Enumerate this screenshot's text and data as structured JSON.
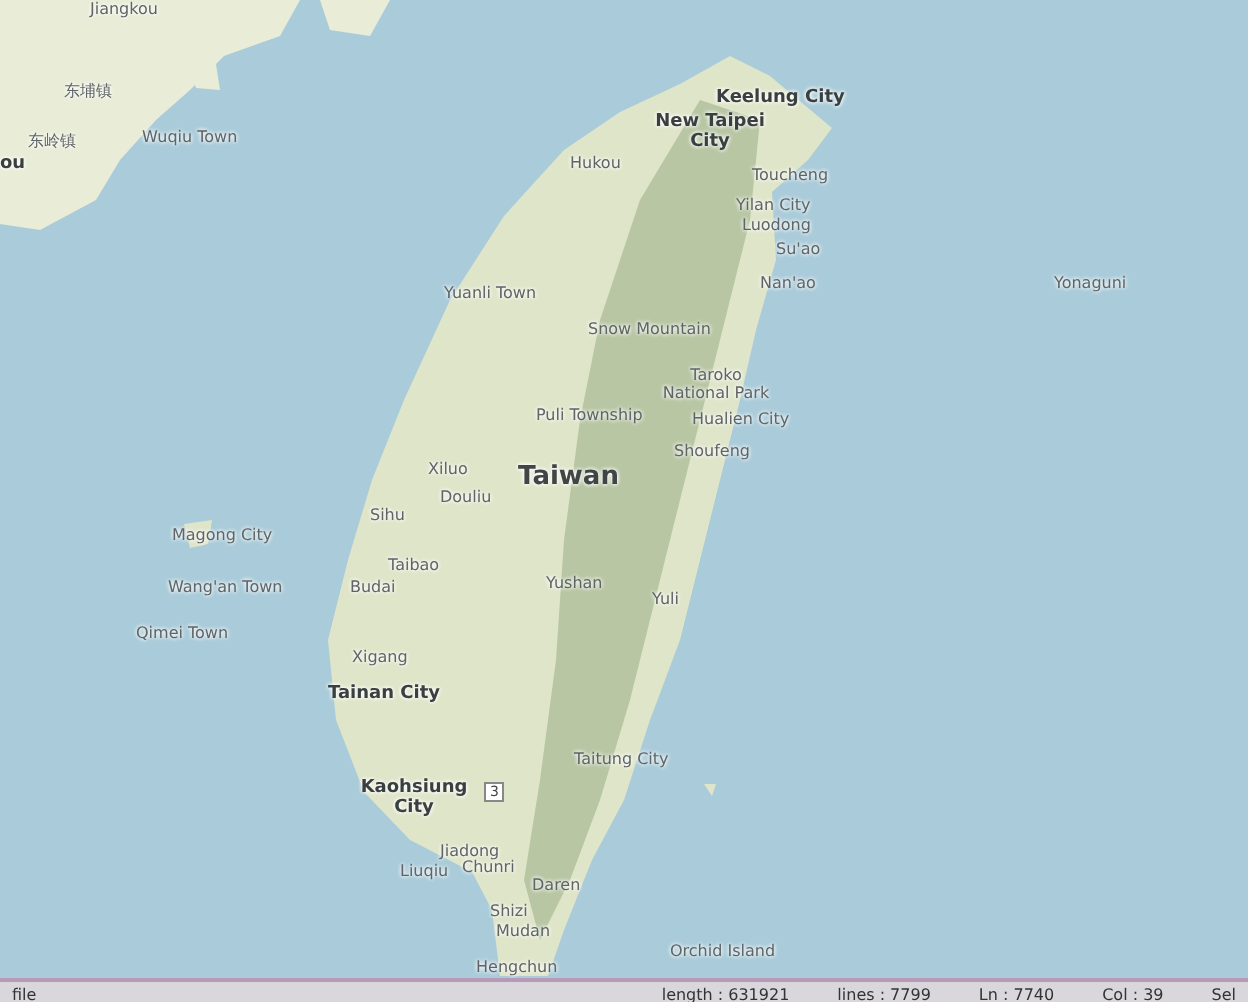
{
  "map": {
    "labels": [
      {
        "text": "Jiangkou",
        "kind": "town"
      },
      {
        "text": "东埔镇",
        "kind": "town"
      },
      {
        "text": "东岭镇",
        "kind": "town"
      },
      {
        "text": "ou",
        "kind": "city"
      },
      {
        "text": "Wuqiu Town",
        "kind": "town"
      },
      {
        "text": "Keelung City",
        "kind": "city"
      },
      {
        "text": "New Taipei City",
        "kind": "city"
      },
      {
        "text": "Hukou",
        "kind": "town"
      },
      {
        "text": "Toucheng",
        "kind": "town"
      },
      {
        "text": "Yilan City",
        "kind": "town"
      },
      {
        "text": "Luodong",
        "kind": "town"
      },
      {
        "text": "Su'ao",
        "kind": "town"
      },
      {
        "text": "Nan'ao",
        "kind": "town"
      },
      {
        "text": "Yuanli Town",
        "kind": "town"
      },
      {
        "text": "Snow Mountain",
        "kind": "town"
      },
      {
        "text": "Taroko National Park",
        "kind": "town"
      },
      {
        "text": "Puli Township",
        "kind": "town"
      },
      {
        "text": "Hualien City",
        "kind": "town"
      },
      {
        "text": "Shoufeng",
        "kind": "town"
      },
      {
        "text": "Taiwan",
        "kind": "country"
      },
      {
        "text": "Xiluo",
        "kind": "town"
      },
      {
        "text": "Douliu",
        "kind": "town"
      },
      {
        "text": "Sihu",
        "kind": "town"
      },
      {
        "text": "Magong City",
        "kind": "town"
      },
      {
        "text": "Taibao",
        "kind": "town"
      },
      {
        "text": "Wang'an Town",
        "kind": "town"
      },
      {
        "text": "Budai",
        "kind": "town"
      },
      {
        "text": "Yushan",
        "kind": "town"
      },
      {
        "text": "Yuli",
        "kind": "town"
      },
      {
        "text": "Qimei Town",
        "kind": "town"
      },
      {
        "text": "Xigang",
        "kind": "town"
      },
      {
        "text": "Tainan City",
        "kind": "city"
      },
      {
        "text": "Taitung City",
        "kind": "town"
      },
      {
        "text": "Kaohsiung City",
        "kind": "city"
      },
      {
        "text": "3",
        "kind": "shield"
      },
      {
        "text": "Jiadong",
        "kind": "town"
      },
      {
        "text": "Chunri",
        "kind": "town"
      },
      {
        "text": "Liuqiu",
        "kind": "town"
      },
      {
        "text": "Daren",
        "kind": "town"
      },
      {
        "text": "Shizi",
        "kind": "town"
      },
      {
        "text": "Mudan",
        "kind": "town"
      },
      {
        "text": "Orchid Island",
        "kind": "town"
      },
      {
        "text": "Hengchun",
        "kind": "town"
      },
      {
        "text": "Yonaguni",
        "kind": "town"
      }
    ]
  },
  "status_bar": [
    "file",
    "length : 631921",
    "lines : 7799",
    "Ln : 7740",
    "Col : 39",
    "Sel"
  ]
}
